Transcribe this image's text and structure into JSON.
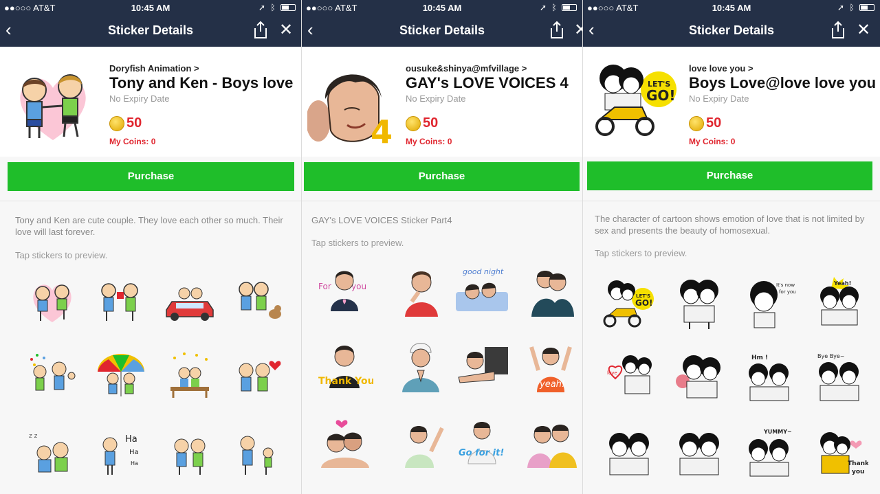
{
  "status": {
    "carrier": "●●○○○ AT&T",
    "time": "10:45 AM",
    "icons": [
      "location-arrow",
      "bluetooth",
      "battery"
    ],
    "battery_level": 0.55
  },
  "colors": {
    "navbar": "#243047",
    "purchase": "#1fbe2a",
    "price": "#e0262f"
  },
  "screens": [
    {
      "nav_title": "Sticker Details",
      "author": "Doryfish Animation >",
      "title": "Tony and Ken - Boys love",
      "expiry": "No Expiry Date",
      "price": "50",
      "my_coins_label": "My Coins:",
      "my_coins_value": "0",
      "purchase": "Purchase",
      "description": "Tony and Ken are cute couple. They love each other so much. Their love will last forever.",
      "hint": "Tap stickers to preview.",
      "stickers": [
        "couple with heart",
        "flower gift",
        "driving car",
        "walking with dog",
        "confetti thumbs up",
        "rainbow umbrella",
        "sitting on bench",
        "heart balloon",
        "sleeping",
        "Ha Ha Ha",
        "sharing",
        "with child"
      ]
    },
    {
      "nav_title": "Sticker Details",
      "author": "ousuke&shinya@mfvillage >",
      "title": "GAY's LOVE VOICES 4",
      "expiry": "No Expiry Date",
      "price": "50",
      "my_coins_label": "My Coins:",
      "my_coins_value": "0",
      "purchase": "Purchase",
      "description": "GAY's LOVE VOICES Sticker Part4",
      "hint": "Tap stickers to preview.",
      "stickers": [
        "For you",
        "thinking",
        "good night",
        "hug",
        "Thank You",
        "praying",
        "sleeping",
        "yeah!",
        "kiss",
        "waving",
        "Go for it!",
        "together"
      ]
    },
    {
      "nav_title": "Sticker Details",
      "author": "love love you >",
      "title": "Boys Love@love love you",
      "expiry": "No Expiry Date",
      "price": "50",
      "my_coins_label": "My Coins:",
      "my_coins_value": "0",
      "purchase": "Purchase",
      "description": "The character of cartoon shows emotion of love that is not limited by sex and presents the beauty of homosexual.",
      "hint": "Tap stickers to preview.",
      "stickers": [
        "LET'S GO!",
        "hugging",
        "It's now for you",
        "Yeah!",
        "love",
        "crying",
        "Hm !",
        "Bye Bye",
        "shy",
        "sad",
        "YUMMY",
        "Thank you"
      ]
    }
  ]
}
